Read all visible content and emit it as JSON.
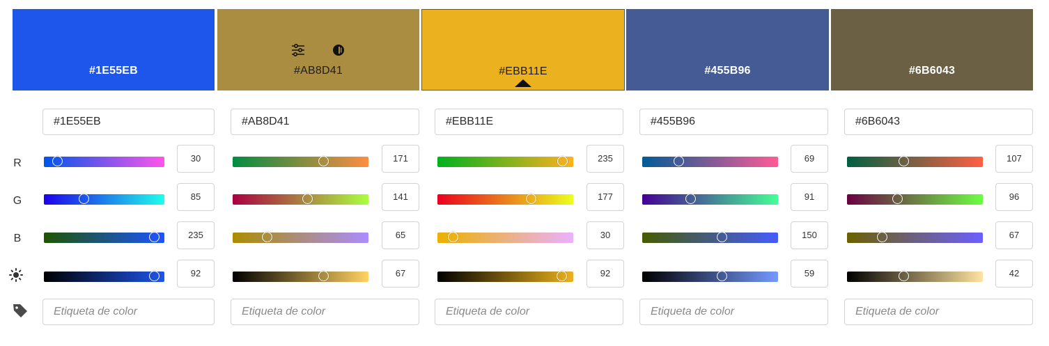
{
  "row_labels": {
    "r": "R",
    "g": "G",
    "b": "B"
  },
  "tag_placeholder": "Etiqueta de color",
  "swatches": [
    {
      "hex": "#1E55EB",
      "color": "#1E55EB",
      "r": 30,
      "g": 85,
      "b": 235,
      "brightness": 92,
      "r_grad": [
        "#0055eb",
        "#ff55eb"
      ],
      "g_grad": [
        "#1e00eb",
        "#1effeb"
      ],
      "b_grad": [
        "#1e5500",
        "#1e55ff"
      ],
      "br_grad": [
        "#000000",
        "#1E55EB"
      ]
    },
    {
      "hex": "#AB8D41",
      "color": "#AB8D41",
      "r": 171,
      "g": 141,
      "b": 65,
      "brightness": 67,
      "r_grad": [
        "#008d41",
        "#ff8d41"
      ],
      "g_grad": [
        "#ab0041",
        "#abff41"
      ],
      "b_grad": [
        "#ab8d00",
        "#ab8dff"
      ],
      "br_grad": [
        "#000000",
        "#ffd263"
      ]
    },
    {
      "hex": "#EBB11E",
      "color": "#EBB11E",
      "r": 235,
      "g": 177,
      "b": 30,
      "brightness": 92,
      "r_grad": [
        "#00b11e",
        "#ffb11e"
      ],
      "g_grad": [
        "#eb001e",
        "#ebff1e"
      ],
      "b_grad": [
        "#ebb100",
        "#ebb1ff"
      ],
      "br_grad": [
        "#000000",
        "#EBB11E"
      ]
    },
    {
      "hex": "#455B96",
      "color": "#455B96",
      "r": 69,
      "g": 91,
      "b": 150,
      "brightness": 59,
      "r_grad": [
        "#005b96",
        "#ff5b96"
      ],
      "g_grad": [
        "#450096",
        "#45ff96"
      ],
      "b_grad": [
        "#455b00",
        "#455bff"
      ],
      "br_grad": [
        "#000000",
        "#7599ff"
      ]
    },
    {
      "hex": "#6B6043",
      "color": "#6B6043",
      "r": 107,
      "g": 96,
      "b": 67,
      "brightness": 42,
      "r_grad": [
        "#006043",
        "#ff6043"
      ],
      "g_grad": [
        "#6b0043",
        "#6bff43"
      ],
      "b_grad": [
        "#6b6000",
        "#6b60ff"
      ],
      "br_grad": [
        "#000000",
        "#ffe4a0"
      ]
    }
  ]
}
